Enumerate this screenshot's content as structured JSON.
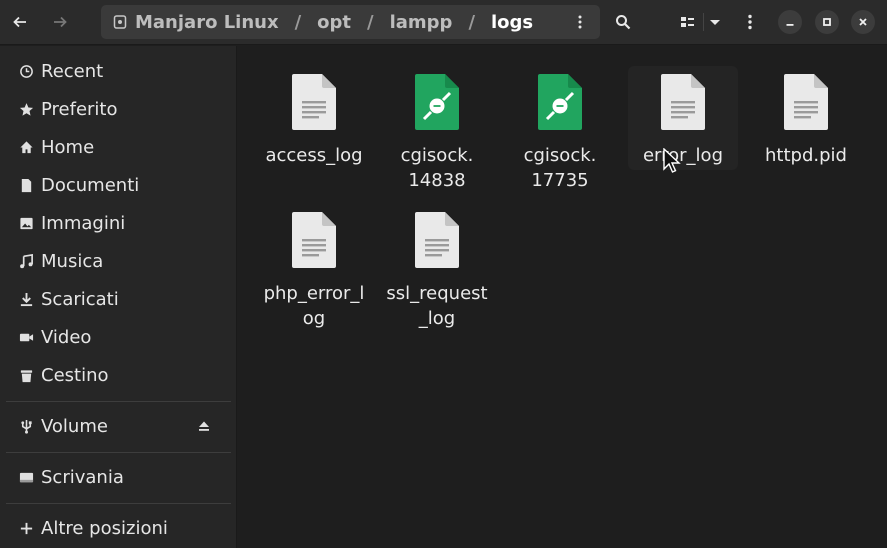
{
  "headerbar": {
    "back_icon": "arrow-left-icon",
    "forward_icon": "arrow-right-icon",
    "path": {
      "segments": [
        "Manjaro Linux",
        "opt",
        "lampp",
        "logs"
      ],
      "separator": "/"
    },
    "search_icon": "search-icon",
    "view_icon": "grid-view-icon",
    "view_menu_icon": "chevron-down-icon",
    "menu_icon": "kebab-menu-icon",
    "window_controls": [
      "minimize",
      "maximize",
      "close"
    ]
  },
  "sidebar": {
    "items": [
      {
        "label": "Recent",
        "icon": "clock-icon"
      },
      {
        "label": "Preferito",
        "icon": "star-icon"
      },
      {
        "label": "Home",
        "icon": "home-icon"
      },
      {
        "label": "Documenti",
        "icon": "document-icon"
      },
      {
        "label": "Immagini",
        "icon": "image-icon"
      },
      {
        "label": "Musica",
        "icon": "music-icon"
      },
      {
        "label": "Scaricati",
        "icon": "download-icon"
      },
      {
        "label": "Video",
        "icon": "video-icon"
      },
      {
        "label": "Cestino",
        "icon": "trash-icon"
      },
      {
        "label": "Volume",
        "icon": "usb-icon"
      },
      {
        "label": "Scrivania",
        "icon": "desktop-icon"
      },
      {
        "label": "Altre posizioni",
        "icon": "plus-icon"
      }
    ]
  },
  "files": [
    {
      "name": "access_log",
      "type": "text"
    },
    {
      "name": "cgisock.\n14838",
      "type": "socket"
    },
    {
      "name": "cgisock.\n17735",
      "type": "socket"
    },
    {
      "name": "error_log",
      "type": "text"
    },
    {
      "name": "httpd.pid",
      "type": "text"
    },
    {
      "name": "php_error_l\nog",
      "type": "text"
    },
    {
      "name": "ssl_request\n_log",
      "type": "text"
    }
  ],
  "colors": {
    "socket_green": "#21a55f",
    "text_file": "#e8e8e8"
  }
}
